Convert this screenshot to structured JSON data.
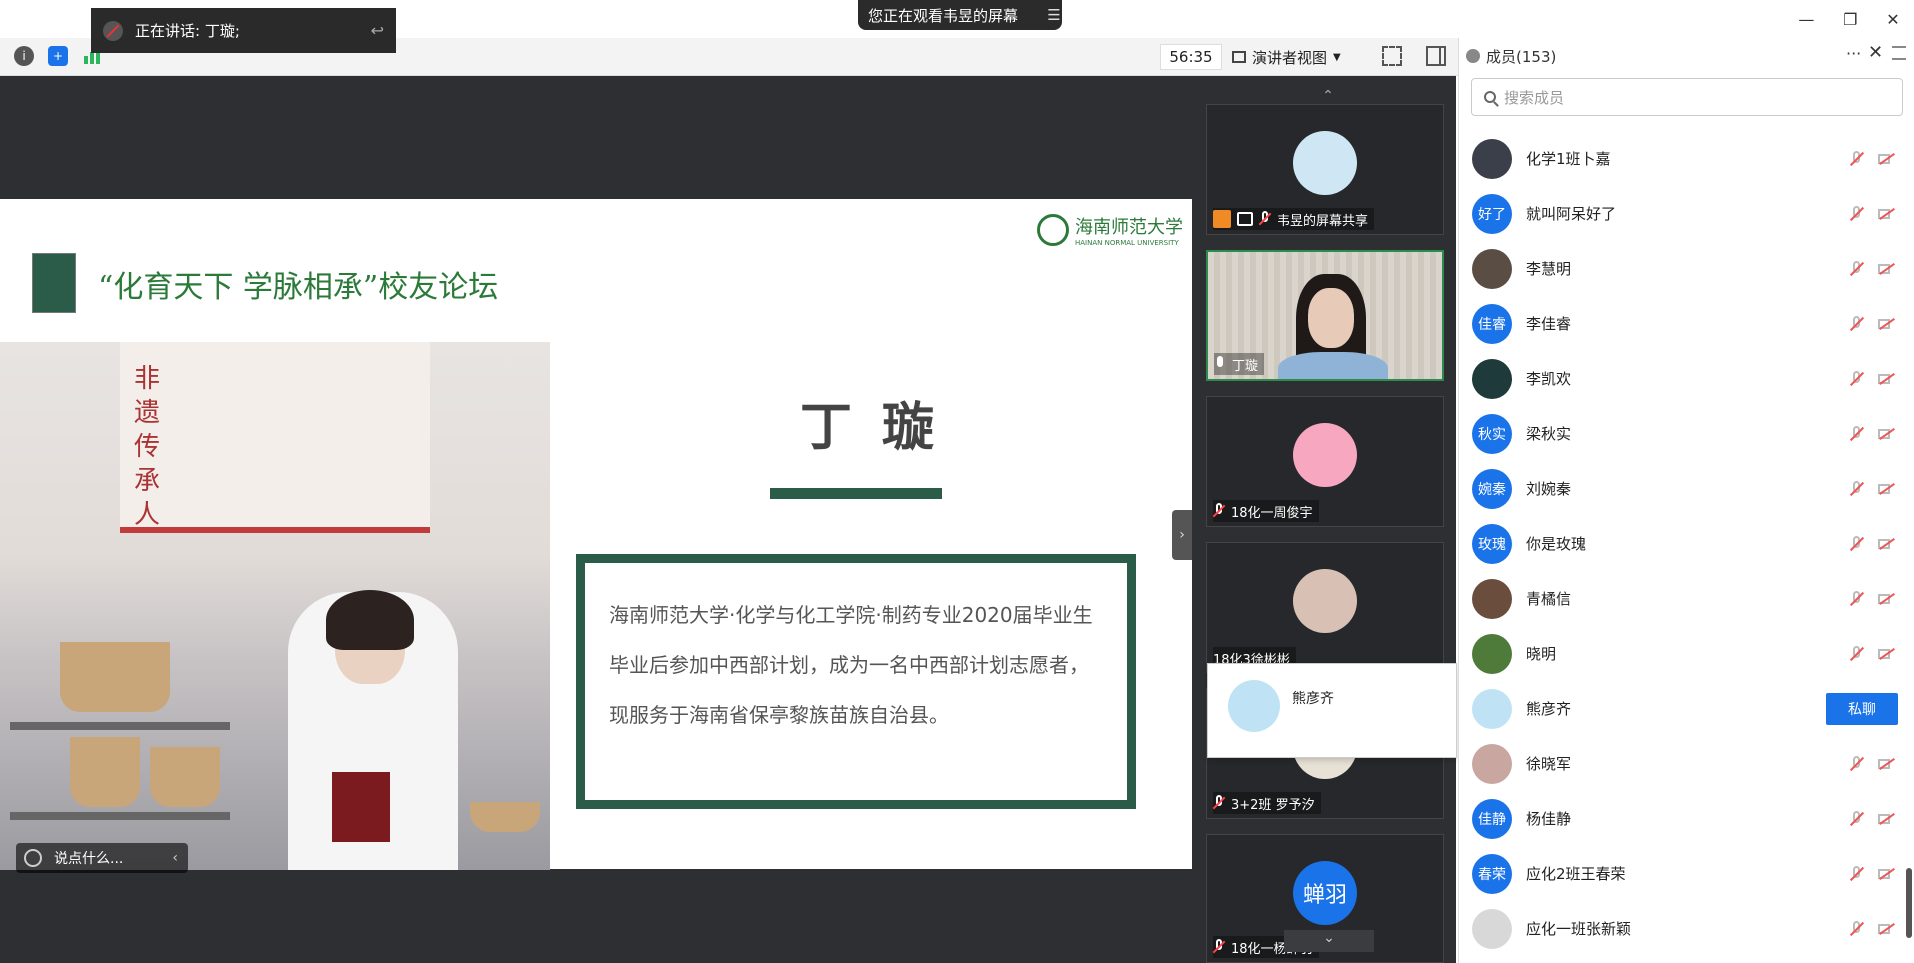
{
  "banner": {
    "text": "您正在观看韦昱的屏幕"
  },
  "speaking": {
    "text": "正在讲话: 丁璇;"
  },
  "toolbar": {
    "timer": "56:35",
    "view_mode": "演讲者视图"
  },
  "slide": {
    "title": "“化育天下 学脉相承”校友论坛",
    "logo_cn": "海南师范大学",
    "logo_en": "HAINAN NORMAL UNIVERSITY",
    "board_text": "非遗传承人",
    "speaker_name": "丁璇",
    "bio": [
      "海南师范大学·化学与化工学院·制药专业2020届毕业生",
      "毕业后参加中西部计划，成为一名中西部计划志愿者，",
      "现服务于海南省保亭黎族苗族自治县。"
    ]
  },
  "comment_box": {
    "placeholder": "说点什么..."
  },
  "video_tiles": [
    {
      "label": "韦昱的屏幕共享",
      "avatar_color": "#cfe6f5"
    },
    {
      "label": "丁璇",
      "avatar_color": ""
    },
    {
      "label": "18化一周俊宇",
      "avatar_color": "#f7a7c0"
    },
    {
      "label": "18化3徐彬彬",
      "avatar_color": "#d8c1b4"
    },
    {
      "label": "3+2班 罗予汐",
      "avatar_color": "#e8e2d6"
    },
    {
      "label": "18化一杨蝉羽",
      "avatar_text": "蝉羽",
      "avatar_color": "#1a73e8"
    }
  ],
  "popup": {
    "name": "熊彦齐"
  },
  "panel": {
    "title": "成员(153)",
    "search_placeholder": "搜索成员",
    "members": [
      {
        "name": "化学1班卜嘉",
        "avatar_color": "#3a3f4a"
      },
      {
        "name": "就叫阿呆好了",
        "avatar_text": "好了",
        "avatar_color": "#1a73e8"
      },
      {
        "name": "李慧明",
        "avatar_color": "#5a4e44"
      },
      {
        "name": "李佳睿",
        "avatar_text": "佳睿",
        "avatar_color": "#1a73e8"
      },
      {
        "name": "李凯欢",
        "avatar_color": "#1e3a3a"
      },
      {
        "name": "梁秋实",
        "avatar_text": "秋实",
        "avatar_color": "#1a73e8"
      },
      {
        "name": "刘婉秦",
        "avatar_text": "婉秦",
        "avatar_color": "#1a73e8"
      },
      {
        "name": "你是玫瑰",
        "avatar_text": "玫瑰",
        "avatar_color": "#1a73e8"
      },
      {
        "name": "青橘信",
        "avatar_color": "#6a4d3c"
      },
      {
        "name": "晓明",
        "avatar_color": "#4e7a3a"
      },
      {
        "name": "熊彦齐",
        "avatar_color": "#bfe3f5",
        "action": "私聊"
      },
      {
        "name": "徐晓军",
        "avatar_color": "#c9a7a0"
      },
      {
        "name": "杨佳静",
        "avatar_text": "佳静",
        "avatar_color": "#1a73e8"
      },
      {
        "name": "应化2班王春荣",
        "avatar_text": "春荣",
        "avatar_color": "#1a73e8"
      },
      {
        "name": "应化一班张新颖",
        "avatar_color": "#d8d8d8"
      }
    ]
  }
}
